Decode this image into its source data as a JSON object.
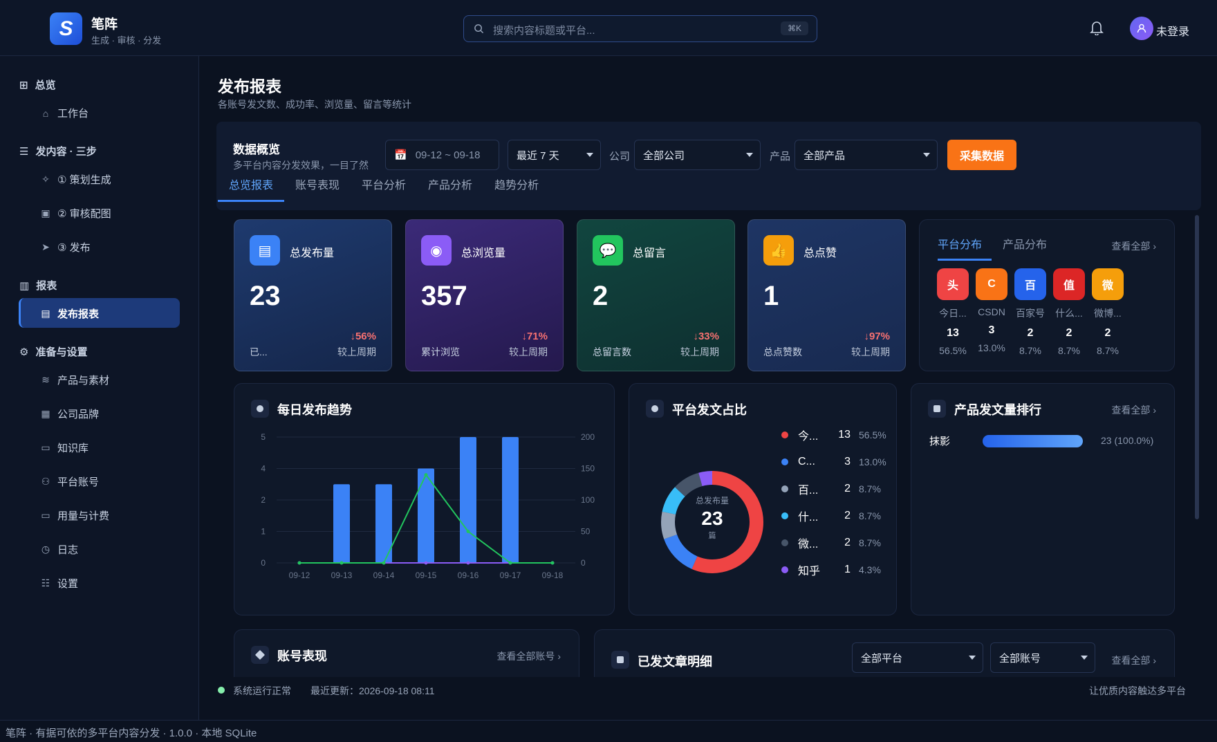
{
  "app": {
    "name": "笔阵",
    "tagline": "生成 · 审核 · 分发",
    "logo_letter": "S"
  },
  "search": {
    "placeholder": "搜索内容标题或平台...",
    "shortcut": "⌘K"
  },
  "user": {
    "login_label": "未登录"
  },
  "sidebar": {
    "groups": [
      {
        "label": "总览",
        "icon": "grid-icon"
      },
      {
        "label": "发内容 · 三步",
        "icon": "menu-icon"
      },
      {
        "label": "报表",
        "icon": "bar-chart-icon"
      },
      {
        "label": "准备与设置",
        "icon": "gear-icon"
      }
    ],
    "items": [
      {
        "label": "工作台",
        "icon": "home-icon"
      },
      {
        "label": "① 策划生成",
        "icon": "sparkle-icon"
      },
      {
        "label": "② 审核配图",
        "icon": "image-icon"
      },
      {
        "label": "③ 发布",
        "icon": "send-icon"
      },
      {
        "label": "发布报表",
        "icon": "document-icon",
        "active": true
      },
      {
        "label": "产品与素材",
        "icon": "layers-icon"
      },
      {
        "label": "公司品牌",
        "icon": "building-icon"
      },
      {
        "label": "知识库",
        "icon": "book-icon"
      },
      {
        "label": "平台账号",
        "icon": "users-icon"
      },
      {
        "label": "用量与计费",
        "icon": "card-icon"
      },
      {
        "label": "日志",
        "icon": "clock-icon"
      },
      {
        "label": "设置",
        "icon": "sliders-icon"
      }
    ]
  },
  "page": {
    "title": "发布报表",
    "subtitle": "各账号发文数、成功率、浏览量、留言等统计"
  },
  "overview": {
    "title": "数据概览",
    "subtitle": "多平台内容分发效果，一目了然",
    "date_range": "09-12 ~ 09-18",
    "period": "最近 7 天",
    "company_label": "公司",
    "company": "全部公司",
    "product_label": "产品",
    "product": "全部产品",
    "collect_button": "采集数据"
  },
  "tabs": [
    "总览报表",
    "账号表现",
    "平台分析",
    "产品分析",
    "趋势分析"
  ],
  "stats": [
    {
      "label": "总发布量",
      "value": "23",
      "change": "↓56%",
      "footer": "已...",
      "compare": "较上周期",
      "color": "#1e3a6e",
      "accent": "#3b82f6",
      "icon": "▤"
    },
    {
      "label": "总浏览量",
      "value": "357",
      "change": "↓71%",
      "footer": "累计浏览",
      "compare": "较上周期",
      "color": "#3b2a78",
      "accent": "#8b5cf6",
      "icon": "◉"
    },
    {
      "label": "总留言",
      "value": "2",
      "change": "↓33%",
      "footer": "总留言数",
      "compare": "较上周期",
      "color": "#11463f",
      "accent": "#22c55e",
      "icon": "💬"
    },
    {
      "label": "总点赞",
      "value": "1",
      "change": "↓97%",
      "footer": "总点赞数",
      "compare": "较上周期",
      "color": "#1e3564",
      "accent": "#f59e0b",
      "icon": "👍"
    }
  ],
  "platform_panel": {
    "tabs": [
      "平台分布",
      "产品分布"
    ],
    "view_all": "查看全部 ›",
    "platforms": [
      {
        "badge": "头",
        "name": "今日...",
        "count": "13",
        "pct": "56.5%",
        "color": "#ef4444"
      },
      {
        "badge": "C",
        "name": "CSDN",
        "count": "3",
        "pct": "13.0%",
        "color": "#f97316"
      },
      {
        "badge": "百",
        "name": "百家号",
        "count": "2",
        "pct": "8.7%",
        "color": "#2563eb"
      },
      {
        "badge": "值",
        "name": "什么...",
        "count": "2",
        "pct": "8.7%",
        "color": "#dc2626"
      },
      {
        "badge": "微",
        "name": "微博...",
        "count": "2",
        "pct": "8.7%",
        "color": "#f59e0b"
      }
    ]
  },
  "trend": {
    "title": "每日发布趋势"
  },
  "chart_data": [
    {
      "type": "bar",
      "categories": [
        "09-12",
        "09-13",
        "09-14",
        "09-15",
        "09-16",
        "09-17",
        "09-18"
      ],
      "series": [
        {
          "values": [
            0,
            3,
            3,
            4,
            5,
            5,
            0
          ],
          "color": "#3b82f6",
          "axis": "left"
        },
        {
          "values": [
            0,
            0,
            0,
            140,
            50,
            0,
            0
          ],
          "color": "#22c55e",
          "axis": "right"
        },
        {
          "values": [
            0,
            0,
            0,
            0,
            0,
            0,
            0
          ],
          "color": "#8b5cf6",
          "axis": "right"
        }
      ],
      "left_ticks": [
        "0",
        "1",
        "2",
        "4",
        "5"
      ],
      "right_ticks": [
        "0",
        "50",
        "100",
        "150",
        "200"
      ],
      "ylim_left": [
        0,
        5
      ],
      "ylim_right": [
        0,
        200
      ]
    },
    {
      "type": "pie",
      "title": "平台发文占比",
      "center_label": "总发布量",
      "center_value": "23",
      "center_unit": "篇",
      "slices": [
        {
          "name": "今...",
          "value": 13,
          "pct": "56.5%",
          "color": "#ef4444"
        },
        {
          "name": "C...",
          "value": 3,
          "pct": "13.0%",
          "color": "#3b82f6"
        },
        {
          "name": "百...",
          "value": 2,
          "pct": "8.7%",
          "color": "#94a3b8"
        },
        {
          "name": "什...",
          "value": 2,
          "pct": "8.7%",
          "color": "#38bdf8"
        },
        {
          "name": "微...",
          "value": 2,
          "pct": "8.7%",
          "color": "#475569"
        },
        {
          "name": "知乎",
          "value": 1,
          "pct": "4.3%",
          "color": "#8b5cf6"
        }
      ]
    }
  ],
  "product_rank": {
    "title": "产品发文量排行",
    "view_all": "查看全部 ›",
    "items": [
      {
        "name": "抹影",
        "value": 23,
        "label": "23 (100.0%)",
        "fraction": 1.0
      }
    ]
  },
  "accounts": {
    "title": "账号表现",
    "view_all": "查看全部账号 ›"
  },
  "articles": {
    "title": "已发文章明细",
    "platform_filter": "全部平台",
    "account_filter": "全部账号",
    "view_all": "查看全部 ›"
  },
  "footer": {
    "status": "系统运行正常",
    "updated": "最近更新：2026-09-18 08:11",
    "slogan": "让优质内容触达多平台"
  },
  "statusbar": {
    "text": "笔阵 · 有据可依的多平台内容分发 · 1.0.0 · 本地 SQLite"
  }
}
